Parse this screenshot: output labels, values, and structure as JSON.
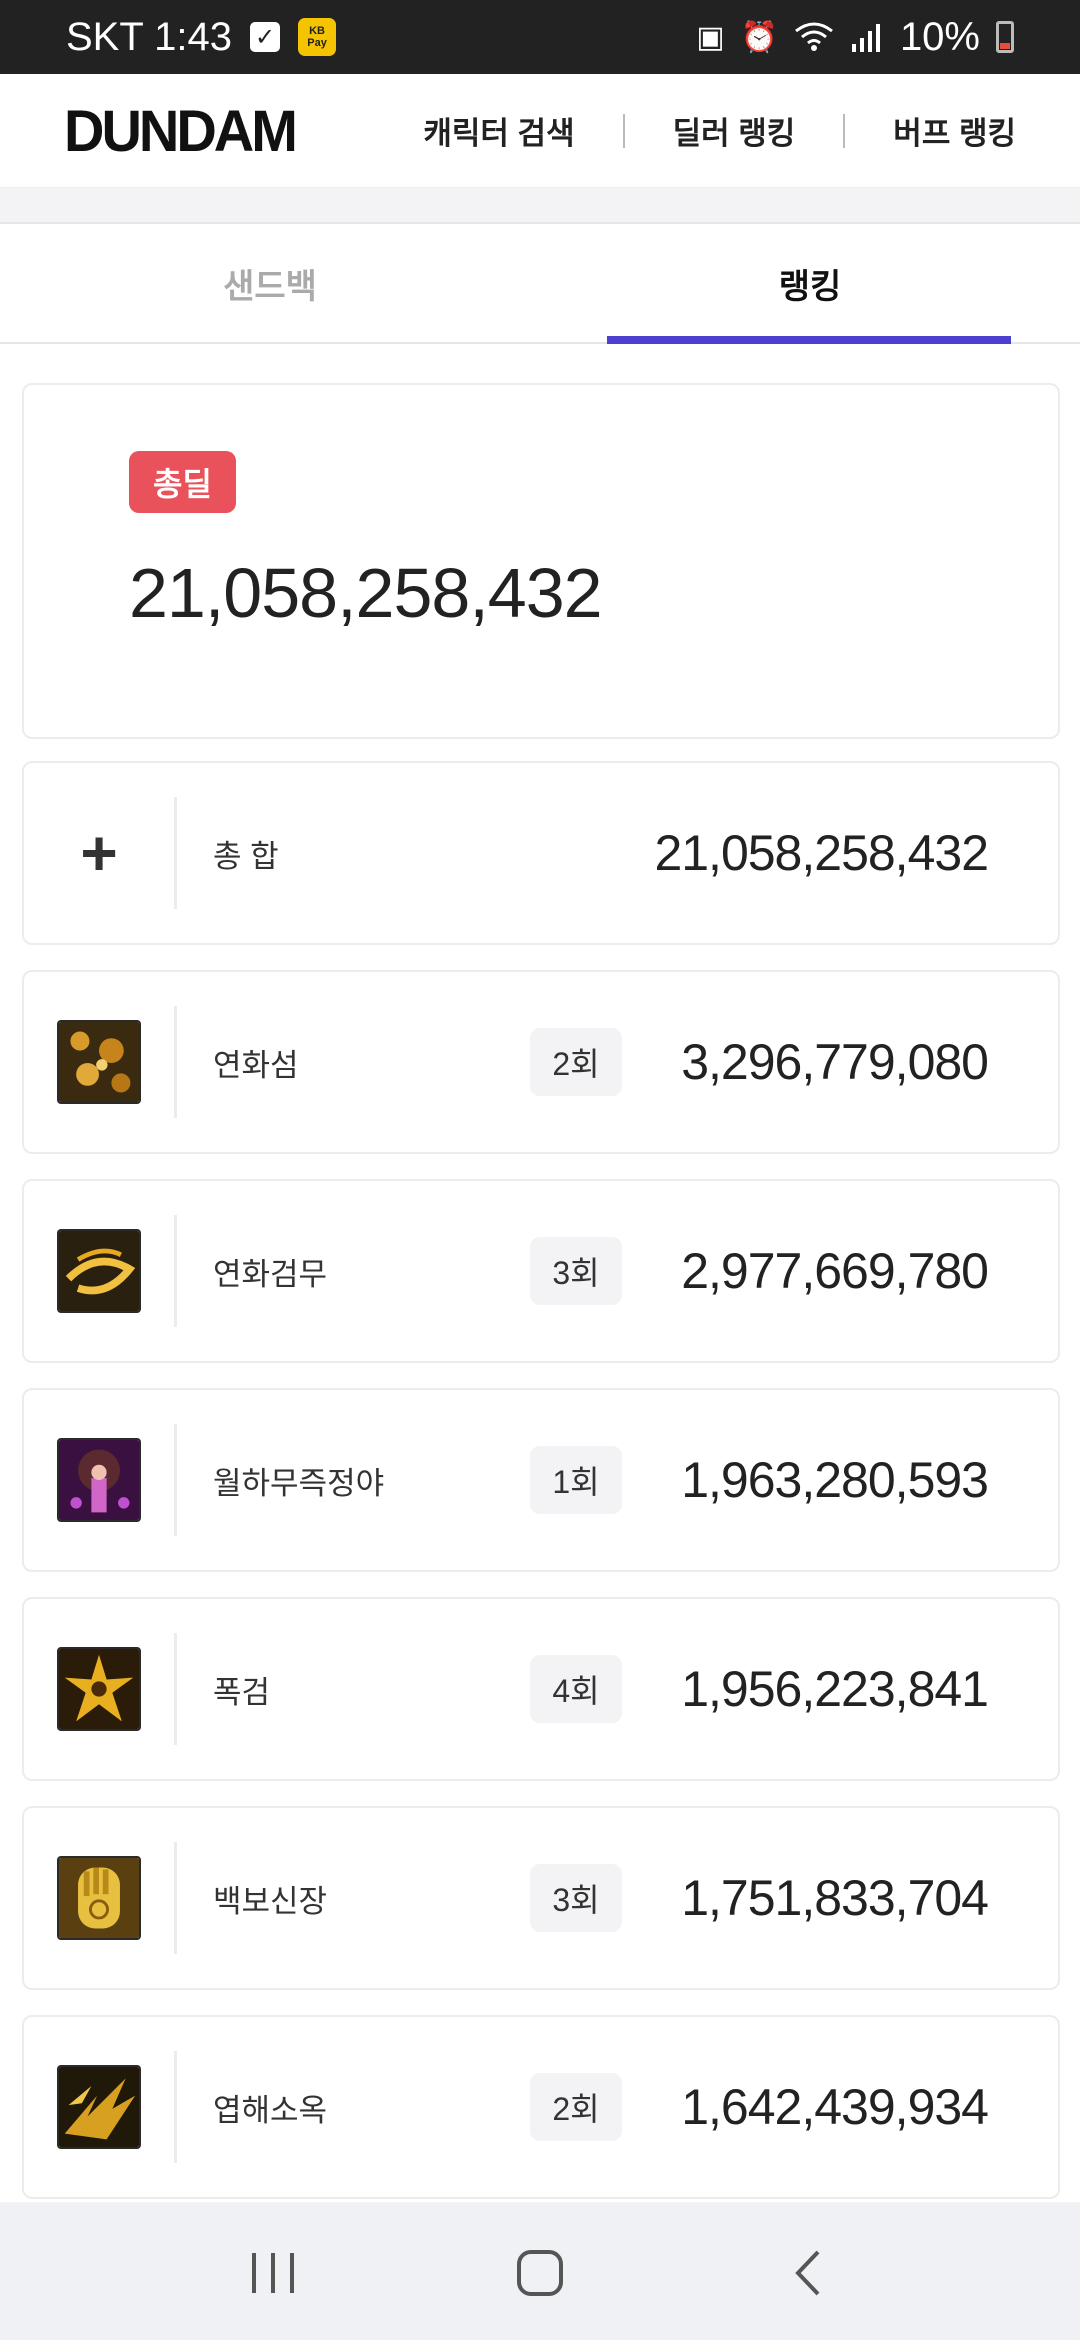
{
  "status_bar": {
    "carrier_time": "SKT 1:43",
    "pay_label_top": "KB",
    "pay_label_bottom": "Pay",
    "battery": "10%"
  },
  "header": {
    "logo": "DUNDAM",
    "nav": [
      "캐릭터 검색",
      "딜러 랭킹",
      "버프 랭킹"
    ]
  },
  "tabs": [
    {
      "label": "샌드백",
      "active": false
    },
    {
      "label": "랭킹",
      "active": true
    }
  ],
  "accent_color": "#4d3fd0",
  "badge_color": "#e9525a",
  "total": {
    "badge": "총딜",
    "value": "21,058,258,432"
  },
  "summary_row": {
    "icon": "plus-icon",
    "name": "총 합",
    "value": "21,058,258,432"
  },
  "skills": [
    {
      "icon": "yeonhwaseom-skill-icon",
      "name": "연화섬",
      "count": "2회",
      "value": "3,296,779,080"
    },
    {
      "icon": "yeonhwageommu-skill-icon",
      "name": "연화검무",
      "count": "3회",
      "value": "2,977,669,780"
    },
    {
      "icon": "wolhamujeukjeongya-skill-icon",
      "name": "월하무즉정야",
      "count": "1회",
      "value": "1,963,280,593"
    },
    {
      "icon": "pokgeom-skill-icon",
      "name": "폭검",
      "count": "4회",
      "value": "1,956,223,841"
    },
    {
      "icon": "baekbosinjang-skill-icon",
      "name": "백보신장",
      "count": "3회",
      "value": "1,751,833,704"
    },
    {
      "icon": "yeophaesook-skill-icon",
      "name": "엽해소옥",
      "count": "2회",
      "value": "1,642,439,934"
    }
  ],
  "bottom_nav": [
    "recent-apps-icon",
    "home-icon",
    "back-icon"
  ]
}
